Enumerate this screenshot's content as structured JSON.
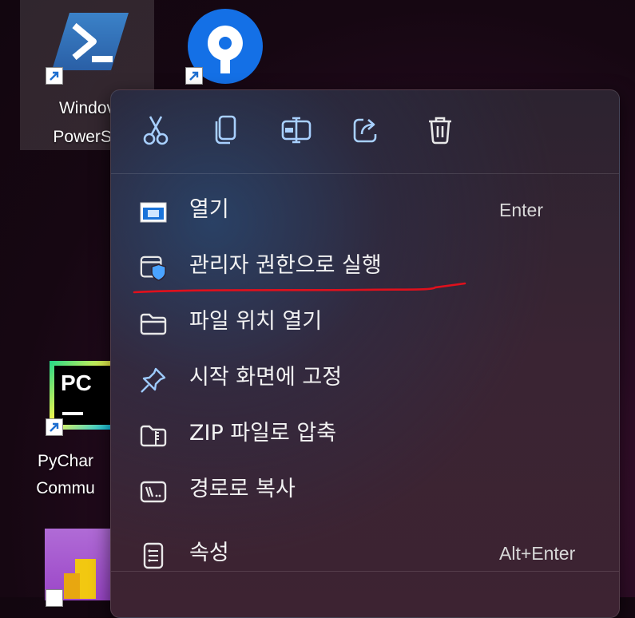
{
  "desktop": {
    "icons": [
      {
        "name": "Windows PowerShell",
        "label_line1": "Windov",
        "label_line2": "PowerSh",
        "selected": true
      },
      {
        "name": "remote-app",
        "label_line1": "",
        "label_line2": ""
      },
      {
        "name": "PyCharm Community",
        "label_line1": "PyChar",
        "label_line2": "Commu",
        "logo_text": "PC"
      },
      {
        "name": "Power BI",
        "label_line1": "",
        "label_line2": ""
      }
    ]
  },
  "context_menu": {
    "toolbar": [
      {
        "icon": "cut-icon",
        "label": "잘라내기"
      },
      {
        "icon": "copy-icon",
        "label": "복사"
      },
      {
        "icon": "rename-icon",
        "label": "이름 바꾸기"
      },
      {
        "icon": "share-icon",
        "label": "공유"
      },
      {
        "icon": "delete-icon",
        "label": "삭제"
      }
    ],
    "items": [
      {
        "icon": "open-icon",
        "label": "열기",
        "shortcut": "Enter"
      },
      {
        "icon": "run-as-admin-icon",
        "label": "관리자 권한으로 실행",
        "shortcut": ""
      },
      {
        "icon": "folder-icon",
        "label": "파일 위치 열기",
        "shortcut": ""
      },
      {
        "icon": "pin-icon",
        "label": "시작 화면에 고정",
        "shortcut": ""
      },
      {
        "icon": "zip-folder-icon",
        "label": "ZIP 파일로 압축",
        "shortcut": ""
      },
      {
        "icon": "copy-path-icon",
        "label": "경로로 복사",
        "shortcut": ""
      },
      {
        "icon": "properties-icon",
        "label": "속성",
        "shortcut": "Alt+Enter"
      }
    ]
  },
  "annotation": {
    "color": "#e0101c",
    "target": "관리자 권한으로 실행"
  },
  "colors": {
    "accent": "#4aa3ff",
    "menu_icon_blue": "#9ecbff"
  }
}
